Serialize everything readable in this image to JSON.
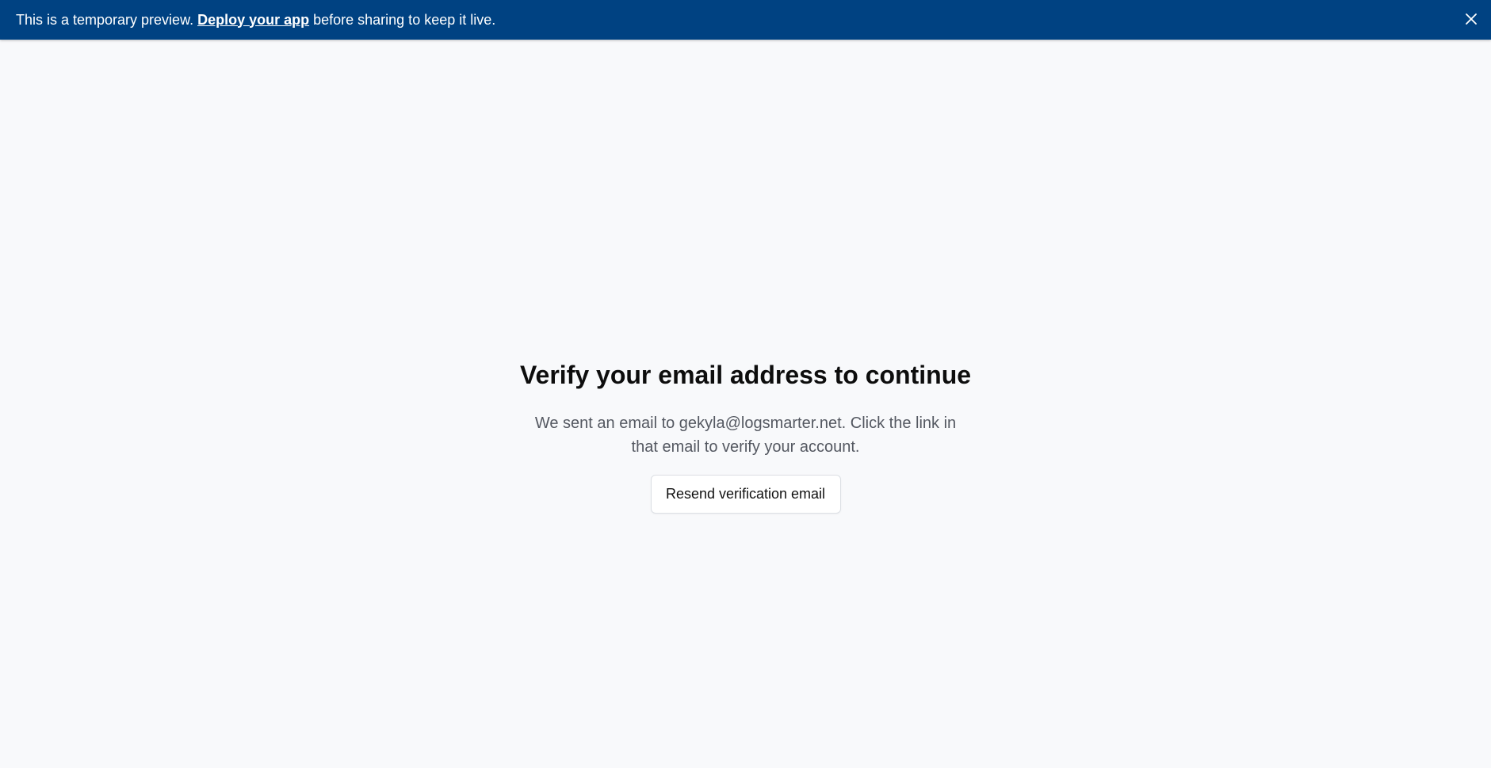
{
  "banner": {
    "text_before": "This is a temporary preview. ",
    "link_text": "Deploy your app",
    "text_after": " before sharing to keep it live.",
    "close_icon": "close-icon",
    "background_color": "#004282"
  },
  "main": {
    "title": "Verify your email address to continue",
    "description": "We sent an email to gekyla@logsmarter.net. Click the link in that email to verify your account.",
    "resend_button_label": "Resend verification email"
  }
}
